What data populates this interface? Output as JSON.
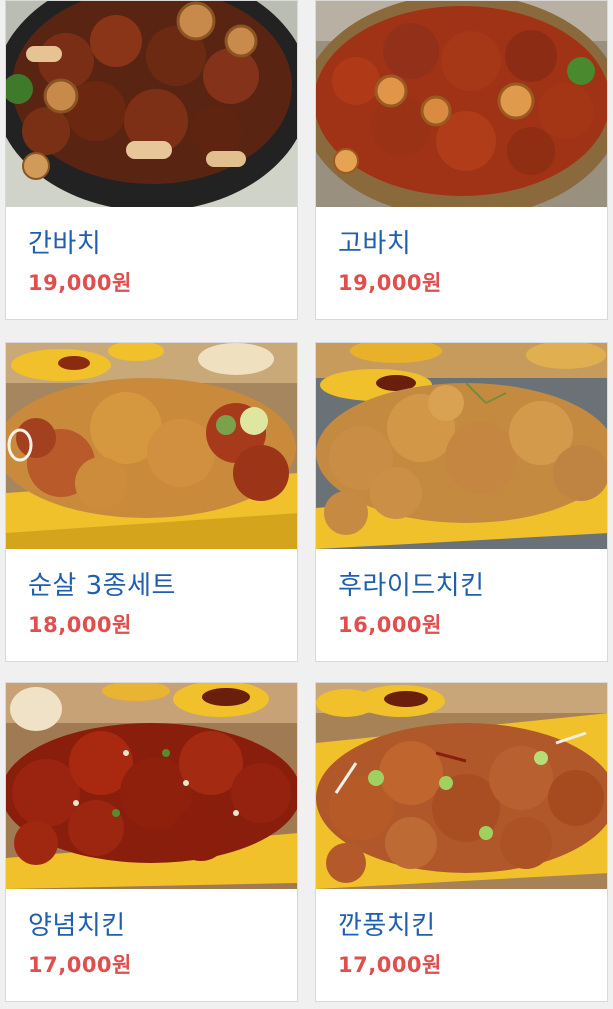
{
  "menu": {
    "items": [
      {
        "name": "간바치",
        "price": "19,000원",
        "image": "soy-glazed-chicken-with-lotus-root-photo"
      },
      {
        "name": "고바치",
        "price": "19,000원",
        "image": "spicy-glazed-chicken-with-lotus-root-photo"
      },
      {
        "name": "순살 3종세트",
        "price": "18,000원",
        "image": "boneless-chicken-three-flavor-set-photo"
      },
      {
        "name": "후라이드치킨",
        "price": "16,000원",
        "image": "fried-chicken-photo"
      },
      {
        "name": "양념치킨",
        "price": "17,000원",
        "image": "seasoned-chicken-photo"
      },
      {
        "name": "깐풍치킨",
        "price": "17,000원",
        "image": "kkanpung-chicken-photo"
      }
    ]
  },
  "colors": {
    "name_text": "#1f5fae",
    "price_text": "#e04e4e",
    "card_background": "#ffffff",
    "page_background": "#f0f0f0"
  }
}
